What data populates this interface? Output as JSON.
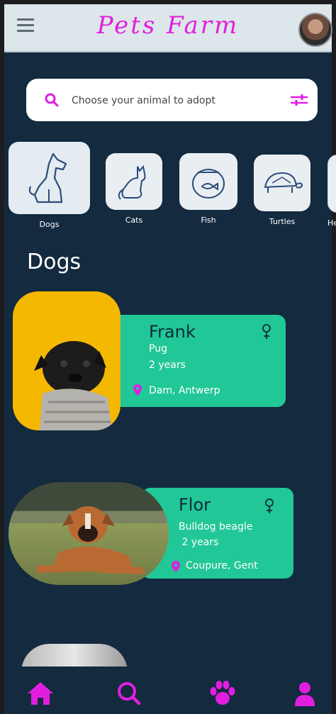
{
  "app": {
    "title": "Pets Farm"
  },
  "search": {
    "placeholder": "Choose your animal to adopt"
  },
  "categories": [
    {
      "label": "Dogs",
      "icon": "dog-icon"
    },
    {
      "label": "Cats",
      "icon": "cat-icon"
    },
    {
      "label": "Fish",
      "icon": "fish-icon"
    },
    {
      "label": "Turtles",
      "icon": "turtle-icon"
    },
    {
      "label": "He",
      "icon": "partial-icon"
    }
  ],
  "section": {
    "title": "Dogs"
  },
  "pets": [
    {
      "name": "Frank",
      "breed": "Pug",
      "age": "2 years",
      "location": "Dam, Antwerp",
      "gender": "female-icon"
    },
    {
      "name": "Flor",
      "breed": "Bulldog beagle",
      "age": " 2 years",
      "location": "Coupure, Gent",
      "gender": "female-icon"
    }
  ],
  "nav": [
    {
      "icon": "home-icon"
    },
    {
      "icon": "search-icon"
    },
    {
      "icon": "paw-icon"
    },
    {
      "icon": "profile-icon"
    }
  ],
  "colors": {
    "background": "#132a3f",
    "accent": "#e11ee0",
    "card": "#21c796",
    "header": "#dde6ea"
  }
}
